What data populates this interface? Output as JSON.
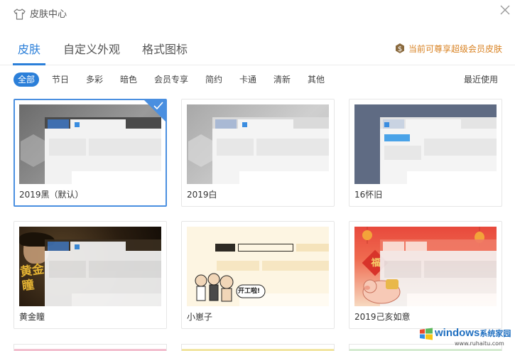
{
  "window": {
    "title": "皮肤中心",
    "close_icon": "close-icon"
  },
  "tabs": [
    {
      "label": "皮肤",
      "active": true
    },
    {
      "label": "自定义外观",
      "active": false
    },
    {
      "label": "格式图标",
      "active": false
    }
  ],
  "member_note": {
    "icon": "coin-icon",
    "text": "当前可尊享超级会员皮肤"
  },
  "categories": [
    {
      "label": "全部",
      "active": true
    },
    {
      "label": "节日"
    },
    {
      "label": "多彩"
    },
    {
      "label": "暗色"
    },
    {
      "label": "会员专享"
    },
    {
      "label": "简约"
    },
    {
      "label": "卡通"
    },
    {
      "label": "清新"
    },
    {
      "label": "其他"
    }
  ],
  "recent_label": "最近使用",
  "skins": [
    {
      "name": "2019黑（默认）",
      "selected": true
    },
    {
      "name": "2019白",
      "selected": false
    },
    {
      "name": "16怀旧",
      "selected": false
    },
    {
      "name": "黄金瞳",
      "selected": false
    },
    {
      "name": "小崽子",
      "selected": false
    },
    {
      "name": "2019己亥如意",
      "selected": false
    }
  ],
  "skin_art_text": {
    "golden_eye": "黄金瞳",
    "cartoon_bubble": "开工啦!",
    "fortune": "福"
  },
  "watermark": {
    "brand": "windows",
    "brand_cn": "系统家园",
    "url": "www.ruhaitu.com"
  },
  "colors": {
    "accent": "#2b7fd9",
    "member": "#d98324"
  }
}
